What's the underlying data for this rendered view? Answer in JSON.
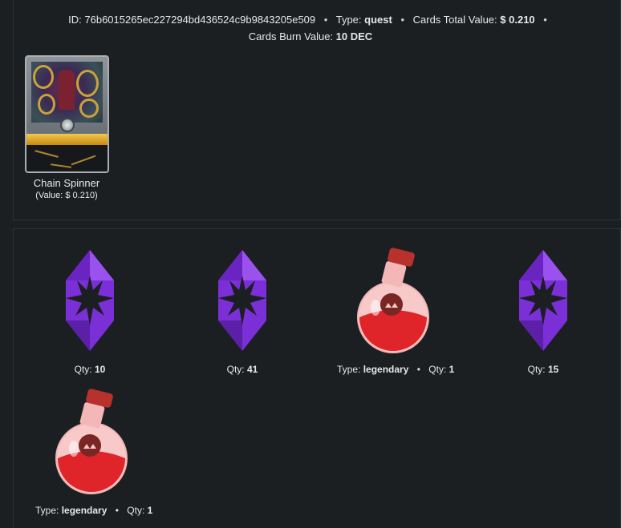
{
  "header": {
    "id_label": "ID:",
    "id_value": "76b6015265ec227294bd436524c9b9843205e509",
    "type_label": "Type:",
    "type_value": "quest",
    "cards_total_label": "Cards Total Value:",
    "cards_total_value": "$ 0.210",
    "burn_label": "Cards Burn Value:",
    "burn_value": "10 DEC",
    "separator": "•"
  },
  "card": {
    "name": "Chain Spinner",
    "value_text": "(Value: $ 0.210)"
  },
  "rewards": [
    {
      "icon": "dec-crystal-icon",
      "qty_label": "Qty:",
      "qty": "10"
    },
    {
      "icon": "dec-crystal-icon",
      "qty_label": "Qty:",
      "qty": "41"
    },
    {
      "icon": "legendary-potion-icon",
      "type_label": "Type:",
      "type": "legendary",
      "qty_label": "Qty:",
      "qty": "1"
    },
    {
      "icon": "dec-crystal-icon",
      "qty_label": "Qty:",
      "qty": "15"
    },
    {
      "icon": "legendary-potion-icon",
      "type_label": "Type:",
      "type": "legendary",
      "qty_label": "Qty:",
      "qty": "1"
    }
  ],
  "colors": {
    "background": "#1b1f22",
    "crystal": "#7b2fd6",
    "potion": "#e0252a"
  }
}
